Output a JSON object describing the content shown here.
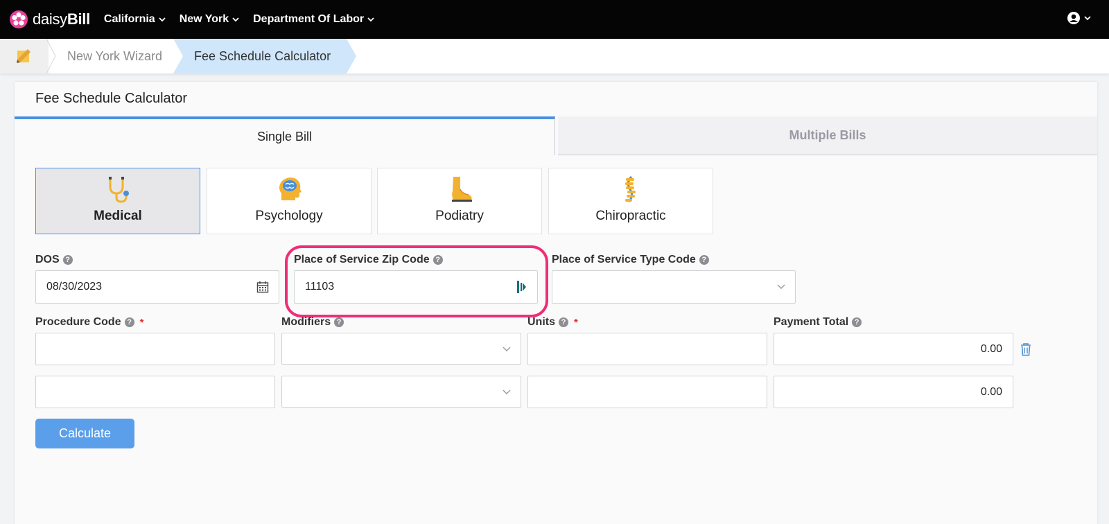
{
  "brand": {
    "prefix": "daisy",
    "suffix": "Bill",
    "accent": "#e8409b"
  },
  "nav": {
    "items": [
      {
        "label": "California"
      },
      {
        "label": "New York"
      },
      {
        "label": "Department Of Labor"
      }
    ],
    "user_icon": "user-circle-icon"
  },
  "breadcrumb": {
    "home_icon": "pencil-note-icon",
    "items": [
      {
        "label": "New York Wizard"
      },
      {
        "label": "Fee Schedule Calculator"
      }
    ]
  },
  "card": {
    "title": "Fee Schedule Calculator",
    "tabs": [
      {
        "label": "Single Bill",
        "active": true
      },
      {
        "label": "Multiple Bills",
        "active": false
      }
    ],
    "specialties": [
      {
        "label": "Medical",
        "icon": "stethoscope-icon",
        "active": true
      },
      {
        "label": "Psychology",
        "icon": "brain-head-icon",
        "active": false
      },
      {
        "label": "Podiatry",
        "icon": "foot-icon",
        "active": false
      },
      {
        "label": "Chiropractic",
        "icon": "spine-icon",
        "active": false
      }
    ]
  },
  "form": {
    "dos": {
      "label": "DOS",
      "value": "08/30/2023"
    },
    "zip": {
      "label": "Place of Service Zip Code",
      "value": "11103"
    },
    "pos_type": {
      "label": "Place of Service Type Code",
      "value": ""
    },
    "procedure": {
      "label": "Procedure Code"
    },
    "modifiers": {
      "label": "Modifiers"
    },
    "units": {
      "label": "Units"
    },
    "payment": {
      "label": "Payment Total"
    },
    "rows": [
      {
        "procedure": "",
        "modifiers": "",
        "units": "",
        "payment": "0.00"
      },
      {
        "procedure": "",
        "modifiers": "",
        "units": "",
        "payment": "0.00"
      }
    ],
    "required_mark": "*",
    "help_mark": "?",
    "calculate_label": "Calculate"
  },
  "colors": {
    "accent": "#4a90e2",
    "highlight": "#ef2e78",
    "button": "#5b9ee9"
  }
}
